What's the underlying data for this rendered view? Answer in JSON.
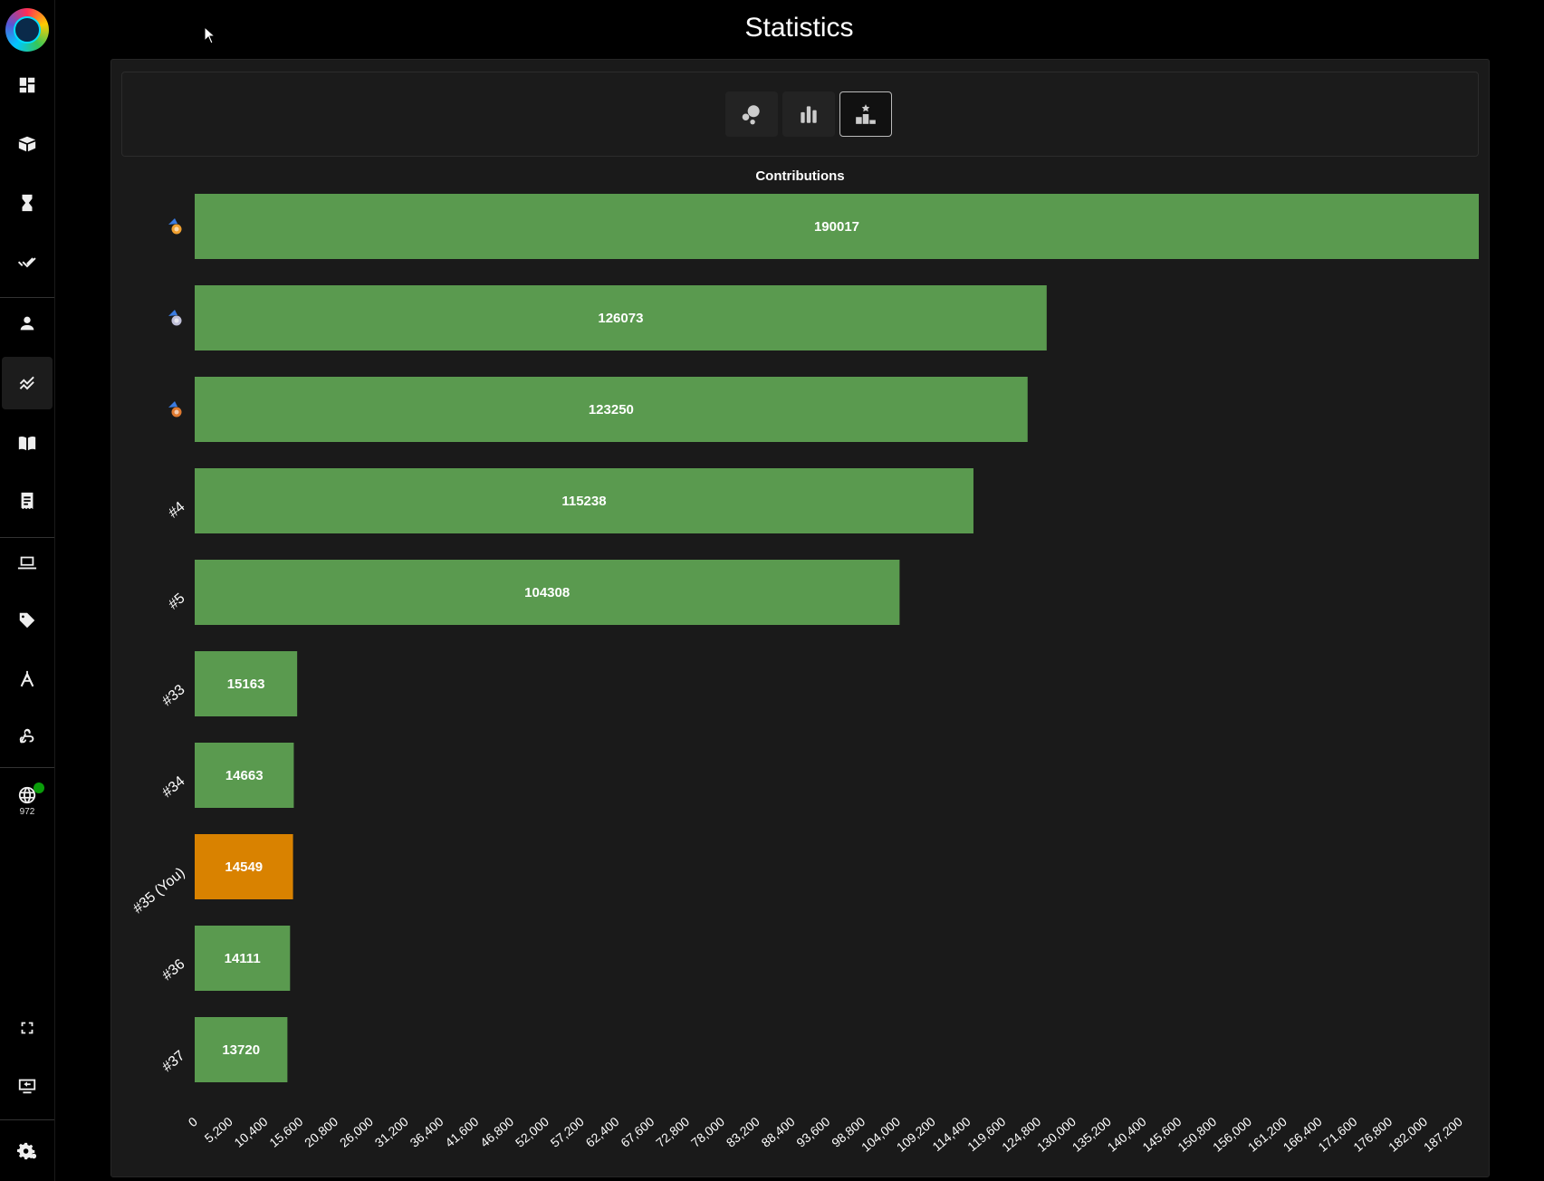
{
  "page": {
    "title": "Statistics"
  },
  "sidebar": {
    "online_count": "972",
    "items": [
      {
        "name": "dashboard",
        "icon": "dashboard-icon"
      },
      {
        "name": "packages",
        "icon": "box-icon"
      },
      {
        "name": "pending",
        "icon": "hourglass-icon"
      },
      {
        "name": "done",
        "icon": "double-check-icon"
      },
      {
        "name": "profile",
        "icon": "person-icon"
      },
      {
        "name": "statistics",
        "icon": "chart-line-icon",
        "active": true
      },
      {
        "name": "docs",
        "icon": "book-open-icon"
      },
      {
        "name": "logs",
        "icon": "receipt-icon"
      },
      {
        "name": "devices",
        "icon": "laptop-icon"
      },
      {
        "name": "tags",
        "icon": "tag-icon"
      },
      {
        "name": "tools",
        "icon": "compass-icon"
      },
      {
        "name": "webhooks",
        "icon": "webhook-icon"
      },
      {
        "name": "online",
        "icon": "globe-icon"
      },
      {
        "name": "fullscreen",
        "icon": "fullscreen-icon"
      },
      {
        "name": "remote",
        "icon": "screen-share-icon"
      },
      {
        "name": "settings",
        "icon": "gear-icon"
      }
    ]
  },
  "toolbar": {
    "buttons": [
      {
        "name": "bubble-chart",
        "icon": "bubbles-icon"
      },
      {
        "name": "bar-chart",
        "icon": "bar-chart-icon"
      },
      {
        "name": "leaderboard",
        "icon": "podium-icon",
        "selected": true
      }
    ]
  },
  "colors": {
    "bar": "#5a9a4f",
    "you_bar": "#d98200",
    "panel": "#1a1a1a"
  },
  "chart_data": {
    "type": "bar",
    "orientation": "horizontal",
    "title": "Contributions",
    "categories": [
      "gold-medal",
      "silver-medal",
      "bronze-medal",
      "#4",
      "#5",
      "#33",
      "#34",
      "#35 (You)",
      "#36",
      "#37"
    ],
    "category_display": [
      {
        "kind": "icon",
        "icon": "gold-medal-icon"
      },
      {
        "kind": "icon",
        "icon": "silver-medal-icon"
      },
      {
        "kind": "icon",
        "icon": "bronze-medal-icon"
      },
      {
        "kind": "text",
        "label": "#4"
      },
      {
        "kind": "text",
        "label": "#5"
      },
      {
        "kind": "text",
        "label": "#33"
      },
      {
        "kind": "text",
        "label": "#34"
      },
      {
        "kind": "text",
        "label": "#35 (You)"
      },
      {
        "kind": "text",
        "label": "#36"
      },
      {
        "kind": "text",
        "label": "#37"
      }
    ],
    "values": [
      190017,
      126073,
      123250,
      115238,
      104308,
      15163,
      14663,
      14549,
      14111,
      13720
    ],
    "highlight_index": 7,
    "xlim": [
      0,
      190017
    ],
    "xticks": [
      "0",
      "5,200",
      "10,400",
      "15,600",
      "20,800",
      "26,000",
      "31,200",
      "36,400",
      "41,600",
      "46,800",
      "52,000",
      "57,200",
      "62,400",
      "67,600",
      "72,800",
      "78,000",
      "83,200",
      "88,400",
      "93,600",
      "98,800",
      "104,000",
      "109,200",
      "114,400",
      "119,600",
      "124,800",
      "130,000",
      "135,200",
      "140,400",
      "145,600",
      "150,800",
      "156,000",
      "161,200",
      "166,400",
      "171,600",
      "176,800",
      "182,000",
      "187,200"
    ],
    "grid": false
  }
}
